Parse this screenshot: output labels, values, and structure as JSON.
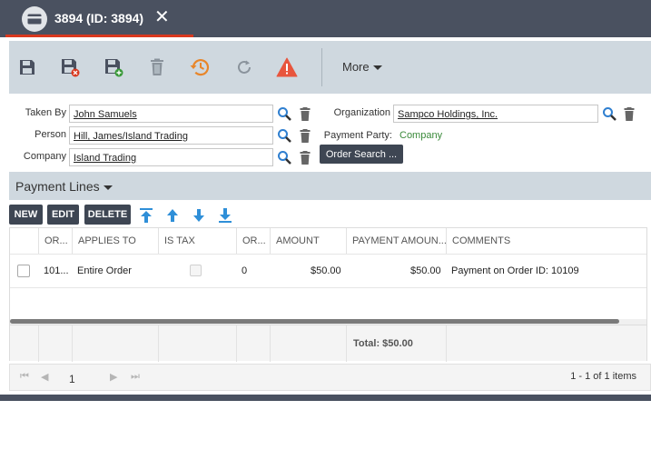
{
  "tab": {
    "title": "3894 (ID: 3894)",
    "close_glyph": "✕"
  },
  "toolbar": {
    "more_label": "More"
  },
  "form": {
    "taken_by": {
      "label": "Taken By",
      "value": "John Samuels"
    },
    "person": {
      "label": "Person",
      "value": "Hill, James/Island Trading"
    },
    "company": {
      "label": "Company",
      "value": "Island Trading"
    },
    "organization": {
      "label": "Organization",
      "value": "Sampco Holdings, Inc."
    },
    "payment_party": {
      "label": "Payment Party:",
      "value": "Company"
    },
    "order_search_label": "Order Search ..."
  },
  "payment_lines": {
    "title": "Payment Lines",
    "buttons": {
      "new": "NEW",
      "edit": "EDIT",
      "delete": "DELETE"
    },
    "columns": [
      "OR...",
      "APPLIES TO",
      "IS TAX",
      "OR...",
      "AMOUNT",
      "PAYMENT AMOUN...",
      "COMMENTS"
    ],
    "rows": [
      {
        "order": "101...",
        "applies_to": "Entire Order",
        "is_tax": false,
        "or2": "0",
        "amount": "$50.00",
        "payment_amount": "$50.00",
        "comments": "Payment on Order ID: 10109"
      }
    ],
    "total": "Total: $50.00"
  },
  "pager": {
    "page": "1",
    "info": "1 - 1 of 1 items"
  },
  "colors": {
    "accent": "#d9381e",
    "dark": "#3e4653",
    "panel": "#cfd8df",
    "warning": "#e8553d",
    "history": "#e8862a",
    "blue_arrow": "#2f8fd8"
  }
}
